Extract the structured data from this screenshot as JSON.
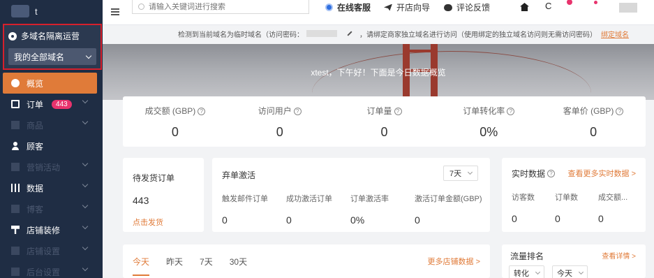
{
  "sidebar": {
    "brand_name": "t",
    "domain_section_title": "多域名隔离运营",
    "domain_select_value": "我的全部域名",
    "items": [
      {
        "label": "概览",
        "icon": "dashboard-icon"
      },
      {
        "label": "订单",
        "icon": "order-icon",
        "badge": "443"
      },
      {
        "label": "商品",
        "icon": "product-icon"
      },
      {
        "label": "顾客",
        "icon": "user-icon"
      },
      {
        "label": "营销活动",
        "icon": "marketing-icon"
      },
      {
        "label": "数据",
        "icon": "chart-icon"
      },
      {
        "label": "博客",
        "icon": "blog-icon"
      },
      {
        "label": "店铺装修",
        "icon": "brush-icon"
      },
      {
        "label": "店铺设置",
        "icon": "store-settings-icon"
      },
      {
        "label": "后台设置",
        "icon": "admin-settings-icon"
      }
    ]
  },
  "topbar": {
    "search_placeholder": "请输入关键词进行搜索",
    "links": [
      "在线客服",
      "开店向导",
      "评论反馈"
    ]
  },
  "notice": {
    "text_before": "检测到当前域名为临时域名（访问密码：",
    "text_after": "，请绑定商家独立域名进行访问（使用绑定的独立域名访问则无需访问密码）",
    "link": "绑定域名"
  },
  "banner": {
    "greeting": "xtest，下午好！下面是今日数据概览"
  },
  "stats": [
    {
      "label": "成交额 (GBP)",
      "value": "0"
    },
    {
      "label": "访问用户",
      "value": "0"
    },
    {
      "label": "订单量",
      "value": "0"
    },
    {
      "label": "订单转化率",
      "value": "0%"
    },
    {
      "label": "客单价 (GBP)",
      "value": "0"
    }
  ],
  "pending_orders": {
    "title": "待发货订单",
    "count": "443",
    "action": "点击发货"
  },
  "abandoned": {
    "title": "弃单激活",
    "period": "7天",
    "metrics": [
      {
        "label": "触发邮件订单",
        "value": "0"
      },
      {
        "label": "成功激活订单",
        "value": "0"
      },
      {
        "label": "订单激活率",
        "value": "0%"
      },
      {
        "label": "激活订单金额(GBP)",
        "value": "0"
      }
    ]
  },
  "realtime": {
    "title": "实时数据",
    "more": "查看更多实时数据 >",
    "metrics": [
      {
        "label": "访客数",
        "value": "0"
      },
      {
        "label": "订单数",
        "value": "0"
      },
      {
        "label": "成交额...",
        "value": "0"
      }
    ]
  },
  "store_data": {
    "tabs": [
      "今天",
      "昨天",
      "7天",
      "30天"
    ],
    "more": "更多店铺数据 >"
  },
  "traffic": {
    "title": "流量排名",
    "more": "查看详情 >",
    "metric_select": "转化",
    "period_select": "今天"
  }
}
